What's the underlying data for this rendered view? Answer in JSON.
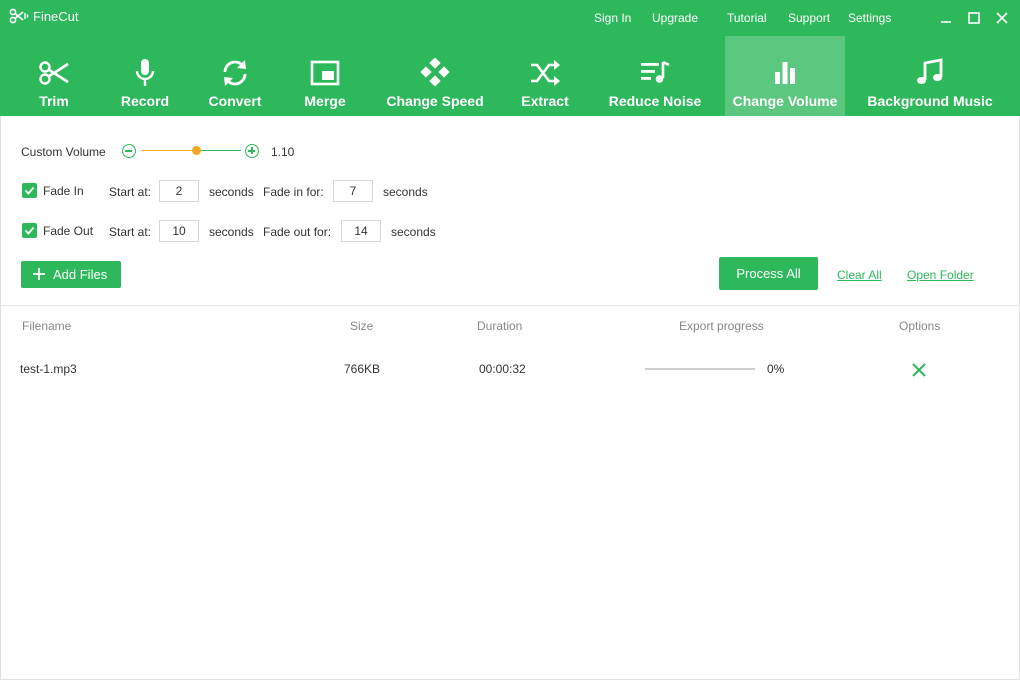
{
  "app": {
    "title": "FineCut"
  },
  "colors": {
    "brand": "#2eb85c",
    "accent_orange": "#f5a623"
  },
  "topnav": {
    "sign_in": "Sign In",
    "upgrade": "Upgrade",
    "tutorial": "Tutorial",
    "support": "Support",
    "settings": "Settings"
  },
  "window_controls": [
    "minimize-icon",
    "maximize-icon",
    "close-icon"
  ],
  "tools": [
    {
      "label": "Trim",
      "icon": "scissors-icon"
    },
    {
      "label": "Record",
      "icon": "microphone-icon"
    },
    {
      "label": "Convert",
      "icon": "refresh-icon"
    },
    {
      "label": "Merge",
      "icon": "merge-icon"
    },
    {
      "label": "Change Speed",
      "icon": "gamepad-icon"
    },
    {
      "label": "Extract",
      "icon": "shuffle-icon"
    },
    {
      "label": "Reduce Noise",
      "icon": "noise-list-icon"
    },
    {
      "label": "Change Volume",
      "icon": "bar-chart-icon",
      "active": true
    },
    {
      "label": "Background Music",
      "icon": "music-note-icon"
    }
  ],
  "volume": {
    "label": "Custom Volume",
    "value": "1.10",
    "slider_fraction": 0.55
  },
  "fade_in": {
    "label": "Fade In",
    "checked": true,
    "start_label": "Start at:",
    "start_value": "2",
    "seconds1": "seconds",
    "duration_label": "Fade in for:",
    "duration_value": "7",
    "seconds2": "seconds"
  },
  "fade_out": {
    "label": "Fade Out",
    "checked": true,
    "start_label": "Start at:",
    "start_value": "10",
    "seconds1": "seconds",
    "duration_label": "Fade out for:",
    "duration_value": "14",
    "seconds2": "seconds"
  },
  "actions": {
    "add_files": "Add Files",
    "process_all": "Process All",
    "clear_all": "Clear All",
    "open_folder": "Open Folder"
  },
  "table": {
    "columns": [
      "Filename",
      "Size",
      "Duration",
      "Export progress",
      "Options"
    ],
    "rows": [
      {
        "filename": "test-1.mp3",
        "size": "766KB",
        "duration": "00:00:32",
        "progress": "0%",
        "progress_fraction": 0
      }
    ]
  }
}
